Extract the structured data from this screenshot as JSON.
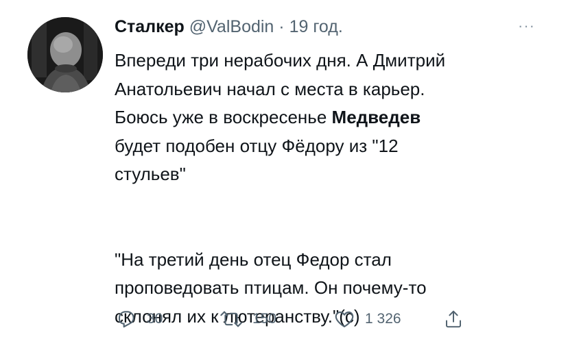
{
  "tweet": {
    "author_name": "Сталкер",
    "handle": "@ValBodin",
    "separator": "·",
    "time": "19 год.",
    "more_label": "···",
    "text_lines": [
      "Впереди три нерабочих дня. А Дмитрий",
      "Анатольевич начал с места в карьер.",
      "Боюсь уже в воскресенье ",
      "Медведев",
      "будет подобен отцу Фёдору из \"12",
      "стульев\"",
      "\"На третий день отец Федор стал",
      "проповедовать птицам. Он почему-то",
      "склонял их к лютеранству.\"(с)"
    ]
  },
  "actions": {
    "reply_icon": "reply-icon",
    "reply_count": "30",
    "retweet_icon": "retweet-icon",
    "retweet_count": "150",
    "like_icon": "heart-icon",
    "like_count": "1 326",
    "share_icon": "share-icon"
  },
  "colors": {
    "text": "#0f1419",
    "secondary": "#536471",
    "background": "#ffffff"
  }
}
